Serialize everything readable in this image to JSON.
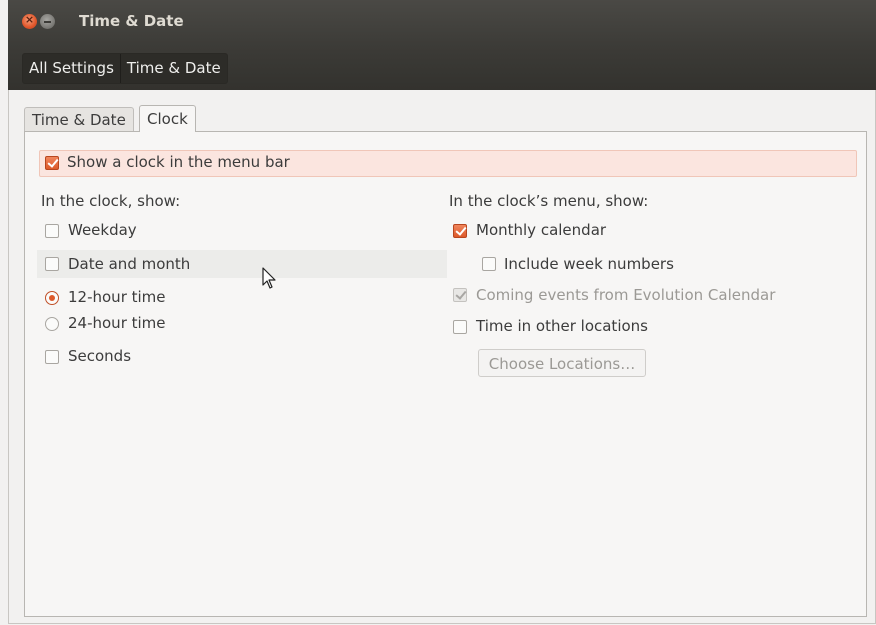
{
  "window": {
    "title": "Time & Date"
  },
  "breadcrumbs": [
    "All Settings",
    "Time & Date"
  ],
  "tabs": [
    {
      "label": "Time & Date",
      "active": false
    },
    {
      "label": "Clock",
      "active": true
    }
  ],
  "show_clock": {
    "label": "Show a clock in the menu bar",
    "checked": true
  },
  "left": {
    "heading": "In the clock, show:",
    "weekday": {
      "label": "Weekday",
      "checked": false
    },
    "date_month": {
      "label": "Date and month",
      "checked": false
    },
    "h12": {
      "label": "12-hour time",
      "selected": true
    },
    "h24": {
      "label": "24-hour time",
      "selected": false
    },
    "seconds": {
      "label": "Seconds",
      "checked": false
    }
  },
  "right": {
    "heading": "In the clock’s menu, show:",
    "monthly": {
      "label": "Monthly calendar",
      "checked": true
    },
    "week_numbers": {
      "label": "Include week numbers",
      "checked": false
    },
    "events": {
      "label": "Coming events from Evolution Calendar",
      "checked": true,
      "disabled": true
    },
    "other_locations": {
      "label": "Time in other locations",
      "checked": false
    },
    "choose_button": "Choose Locations…"
  },
  "colors": {
    "accent": "#dd5a2b",
    "titlebar": "#3c3b37",
    "background": "#f2f1f0"
  }
}
